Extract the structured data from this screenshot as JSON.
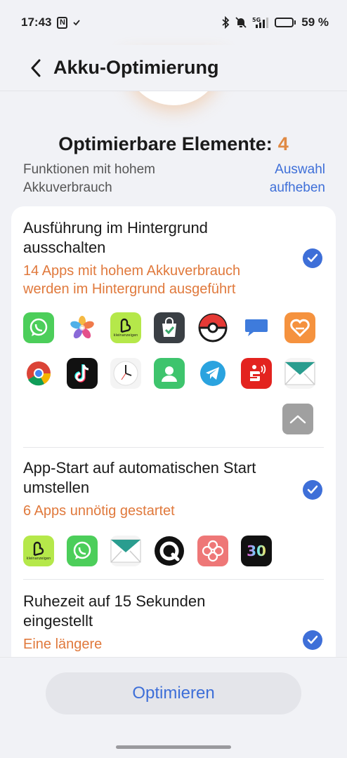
{
  "status_bar": {
    "time": "17:43",
    "nfc_label": "N",
    "network": "5G",
    "battery_percent": "59 %",
    "battery_level": 0.59
  },
  "header": {
    "title": "Akku-Optimierung"
  },
  "summary": {
    "title": "Optimierbare Elemente:",
    "count": "4",
    "subtitle": "Funktionen mit hohem Akkuverbrauch",
    "deselect_label": "Auswahl aufheben"
  },
  "sections": [
    {
      "title": "Ausführung im Hintergrund ausschalten",
      "subtitle": "14 Apps mit hohem Akkuverbrauch werden im Hintergrund ausgeführt",
      "checked": true,
      "apps": [
        "whatsapp-icon",
        "photos-icon",
        "kleinanzeigen-icon",
        "shopping-bag-icon",
        "pokemon-go-icon",
        "messages-icon",
        "orange-heart-app-icon",
        "chrome-icon",
        "tiktok-icon",
        "clock-icon",
        "contacts-icon",
        "telegram-icon",
        "sparkasse-icon",
        "mail-icon"
      ]
    },
    {
      "title": "App-Start auf automatischen Start umstellen",
      "subtitle": "6 Apps unnötig gestartet",
      "checked": true,
      "apps": [
        "kleinanzeigen-icon",
        "whatsapp-icon",
        "mail-icon",
        "qobuz-icon",
        "flower-app-icon",
        "thirty-day-app-icon"
      ]
    },
    {
      "title": "Ruhezeit auf 15 Sekunden eingestellt",
      "subtitle": "Eine längere",
      "checked": true
    }
  ],
  "app_labels": {
    "kleinanzeigen": "kleinanzeigen",
    "thirty": "30"
  },
  "footer": {
    "optimize_label": "Optimieren"
  },
  "colors": {
    "accent_blue": "#3e6fd8",
    "warning_orange": "#e0793c",
    "count_orange": "#e08a44"
  }
}
